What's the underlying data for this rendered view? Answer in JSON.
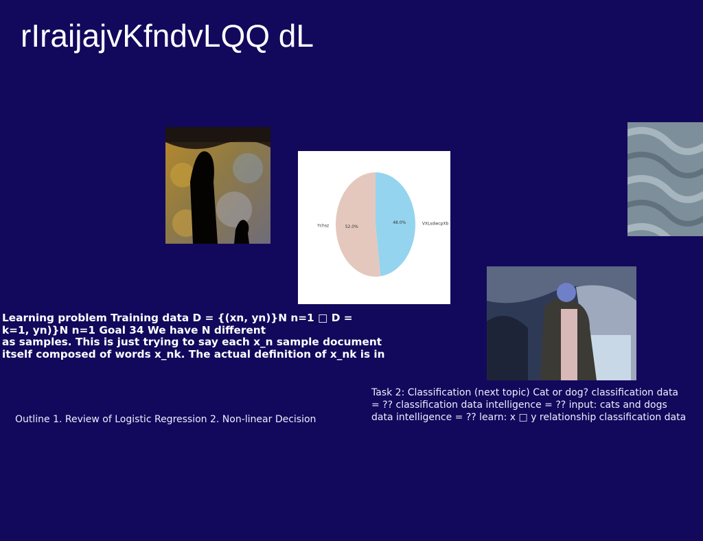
{
  "slide": {
    "title": "rIraijajvKfndvLQQ dL",
    "bold_lines": [
      "Learning problem Training data D = {(xn, yn)}N n=1 □ D =",
      "k=1, yn)}N n=1 Goal 34 We have N different",
      "as samples. This is just trying to say each x_n sample document",
      "itself composed of words x_nk. The actual definition of x_nk is in"
    ],
    "outline": "Outline 1. Review of Logistic Regression 2. Non-linear Decision",
    "task_lines": [
      "Task 2: Classification (next topic) Cat or dog? classification data",
      "= ?? classification data intelligence = ?? input: cats and dogs",
      "data intelligence = ?? learn: x □ y relationship classification data"
    ]
  },
  "chart_data": {
    "type": "pie",
    "categories": [
      "VXLsdwcpXb",
      "Ychsz"
    ],
    "values": [
      48.0,
      52.0
    ],
    "value_labels": [
      "48.0%",
      "52.0%"
    ],
    "colors": [
      "#95d4ef",
      "#e5c8bd"
    ]
  },
  "images": {
    "photo1": "cave-silhouette-photo",
    "photo2": "sand-ripples-photo",
    "photo3": "man-in-coat-photo"
  }
}
